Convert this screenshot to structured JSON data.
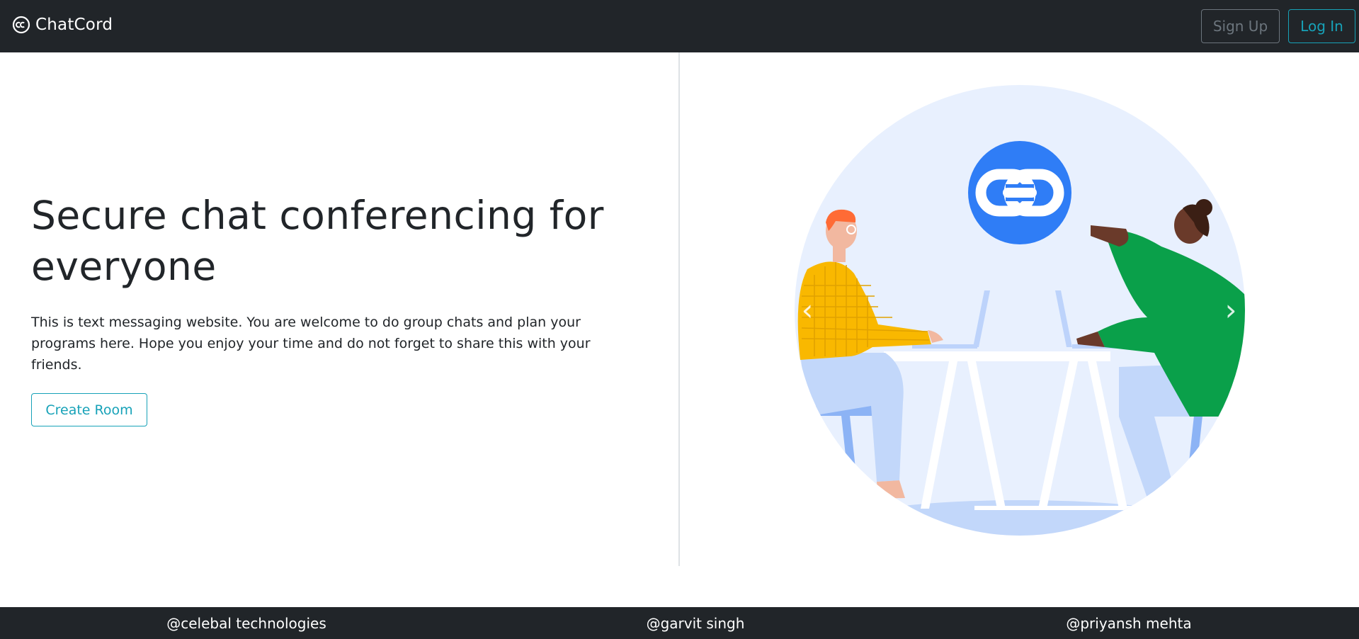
{
  "navbar": {
    "brand": "ChatCord",
    "brand_icon": "cc-logo-icon",
    "signup_label": "Sign Up",
    "login_label": "Log In"
  },
  "hero": {
    "title": "Secure chat conferencing for everyone",
    "description": "This is text messaging website. You are welcome to do group chats and plan your programs here. Hope you enjoy your time and do not forget to share this with your friends.",
    "create_room_label": "Create Room"
  },
  "carousel": {
    "prev_icon": "chevron-left-icon",
    "next_icon": "chevron-right-icon",
    "prev_glyph": "‹",
    "next_glyph": "›"
  },
  "footer": {
    "links": [
      "@celebal technologies",
      "@garvit singh",
      "@priyansh mehta"
    ]
  },
  "colors": {
    "navbar_bg": "#212529",
    "accent": "#17a2b8",
    "secondary": "#6c757d",
    "illustration_bg": "#e8f0fe",
    "link_icon_blue": "#2f7df6"
  }
}
